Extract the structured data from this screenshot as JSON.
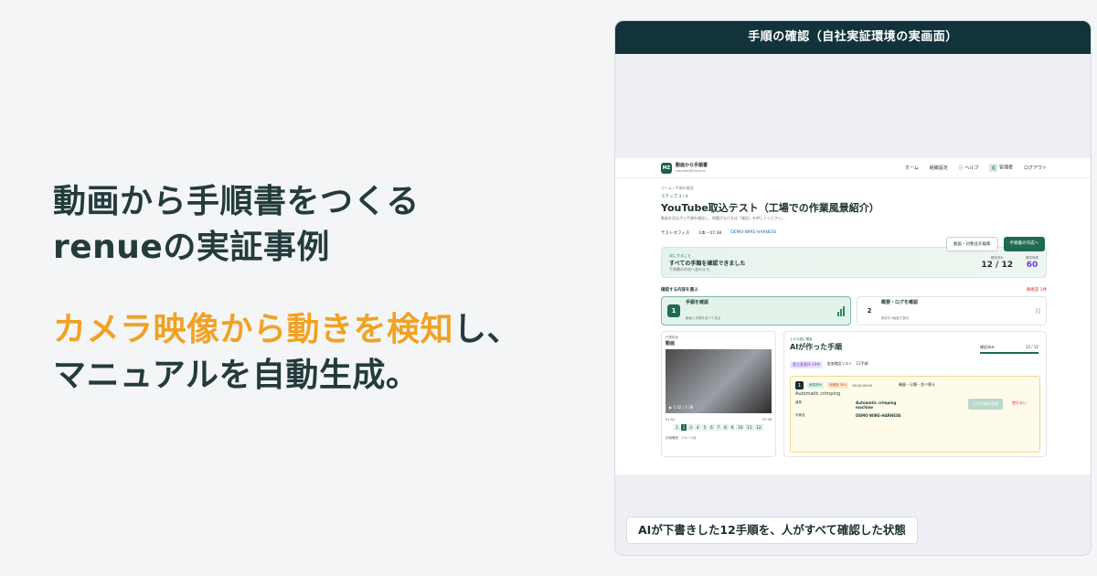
{
  "hero": {
    "title_line1": "動画から手順書をつくる",
    "title_line2": "renueの実証事例",
    "sub_accent": "カメラ映像から動きを検知",
    "sub_rest1": "し、",
    "sub_line2": "マニュアルを自動生成。"
  },
  "panel": {
    "header": "手順の確認（自社実証環境の実画面）",
    "caption": "AIが下書きした12手順を、人がすべて確認した状態"
  },
  "app": {
    "logo": "MZ",
    "brand_name": "動画から手順書",
    "brand_sub": "manuals@renue.ai",
    "nav": [
      "ホーム",
      "組織設定",
      "ヘルプ",
      "管理者",
      "ログアウト"
    ],
    "avatar_label": "管",
    "breadcrumb": "ホーム / 手順の確認",
    "step": "ステップ 3 / 4",
    "title": "YouTube取込テスト（工場での作業風景紹介）",
    "desc": "動画を見ながら手順を確認し、問題がなければ「確認」を押してください。",
    "meta": [
      "テストオフィス",
      "1本・07:38",
      "DEMO-WIRE-HARNESS"
    ],
    "btn_edit": "動画・対象品を編集",
    "btn_create": "手順書の作成へ",
    "done_k": "次にすること",
    "done_t": "すべての手順を確認できました",
    "done_d": "手順書の作成へ進めます。",
    "stat1_label": "確認済み",
    "stat1_value": "12 / 12",
    "stat2_label": "確認時間",
    "stat2_value": "60",
    "select_label": "確認する内容を選ぶ",
    "select_right": "要確認 1件",
    "choice1_title": "手順を確認",
    "choice1_sub": "動画と手順を並べて見る",
    "choice2_title": "概要・ログを確認",
    "choice2_sub": "既存を3画面で表示",
    "video_k": "作業動画",
    "video_t": "動画",
    "video_time": "1:02 / 7:38",
    "time_start": "01:02",
    "time_end": "07:38",
    "steps": [
      "1",
      "2",
      "3",
      "4",
      "5",
      "6",
      "7",
      "8",
      "9",
      "10",
      "11",
      "12"
    ],
    "video_foot": "手順確認　1ページ目",
    "ai_k": "上から順に確認",
    "ai_t": "AIが作った手順",
    "ai_prog_label": "確認済み",
    "ai_prog_value": "12 / 12",
    "tag1": "要注意箇所 60件",
    "tag2": "追加確認リスト",
    "tag3": "12手順",
    "sc_num": "1",
    "sc_pill1": "承認済み",
    "sc_pill2": "信頼度 58%",
    "sc_time": "00:20-00:55",
    "sc_name": "Automatic crimping",
    "sc_right": "機器・分類・並べ替え",
    "sc_btn": "この手順を承認",
    "sc_red": "使わない",
    "g1k": "道具",
    "g1v": "Automatic crimping machine",
    "g2k": "対象品",
    "g2v": "DEMO-WIRE-HARNESS"
  },
  "colors": {
    "accent": "#f0a224",
    "brand": "#1f6b52",
    "dark": "#12333a"
  }
}
